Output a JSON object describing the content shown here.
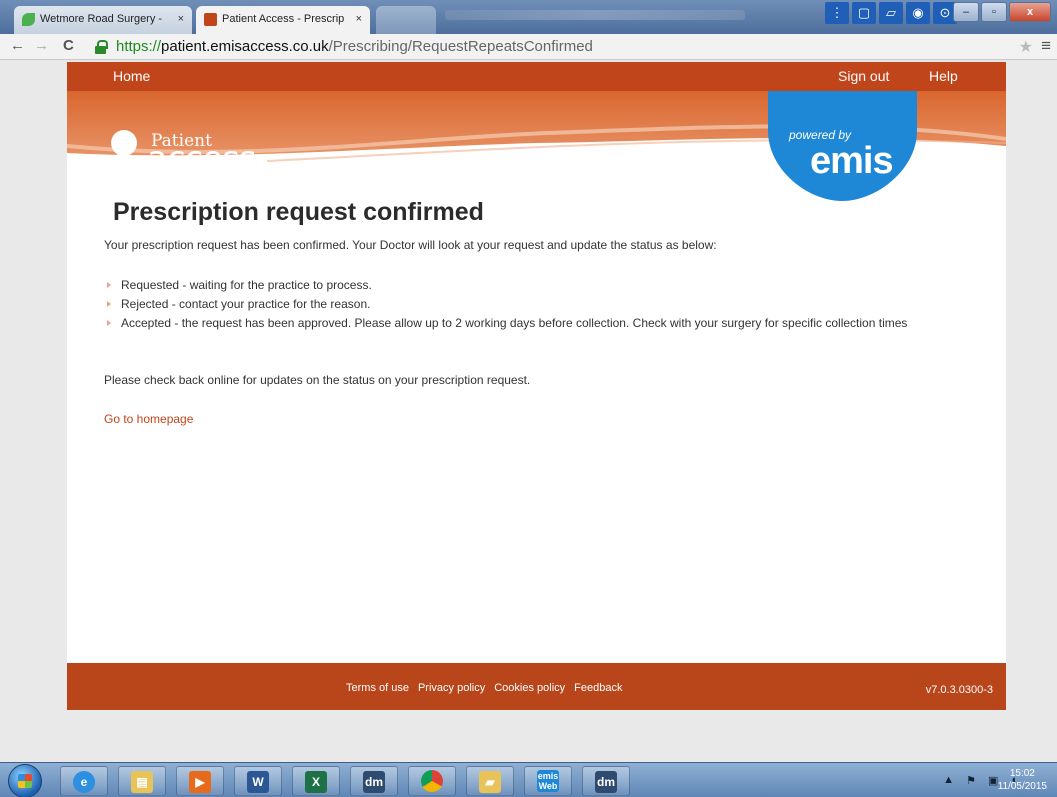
{
  "browser": {
    "tabs": [
      {
        "title": "Wetmore Road Surgery - ",
        "close": "×"
      },
      {
        "title": "Patient Access  - Prescrip",
        "close": "×"
      }
    ],
    "address": {
      "secure": "https://",
      "host": "patient.emisaccess.co.uk",
      "path": "/Prescribing/RequestRepeatsConfirmed"
    }
  },
  "header": {
    "home_label": "Home",
    "signout_label": "Sign out",
    "help_label": "Help",
    "logo_patient": "Patient",
    "logo_access": "access",
    "powered_by": "powered by",
    "emis": "emis"
  },
  "main": {
    "title": "Prescription request confirmed",
    "intro": "Your prescription request has been confirmed. Your Doctor will look at your request and update the status as below:",
    "statuses": [
      "Requested - waiting for the practice to process.",
      "Rejected - contact your practice for the reason.",
      "Accepted - the request has been approved. Please allow up to 2 working days before collection. Check with your surgery for specific collection times"
    ],
    "check_back": "Please check back online for updates on the status on your prescription request.",
    "homepage_link": "Go to homepage"
  },
  "footer": {
    "links": [
      "Terms of use",
      "Privacy policy",
      "Cookies policy",
      "Feedback"
    ],
    "version": "v7.0.3.0300-3"
  },
  "taskbar": {
    "apps": [
      "internet-explorer",
      "file-explorer",
      "media-player",
      "word",
      "excel",
      "dm",
      "chrome",
      "folder",
      "emis-web",
      "dm"
    ],
    "emis_web_label": "emis Web",
    "dm_label": "dm",
    "word_label": "W",
    "excel_label": "X",
    "clock_time": "15:02",
    "clock_date": "11/05/2015"
  },
  "colors": {
    "brand": "#c0451a",
    "footer": "#b9451b",
    "link": "#c0451a",
    "emis_blue": "#1e88d6"
  }
}
